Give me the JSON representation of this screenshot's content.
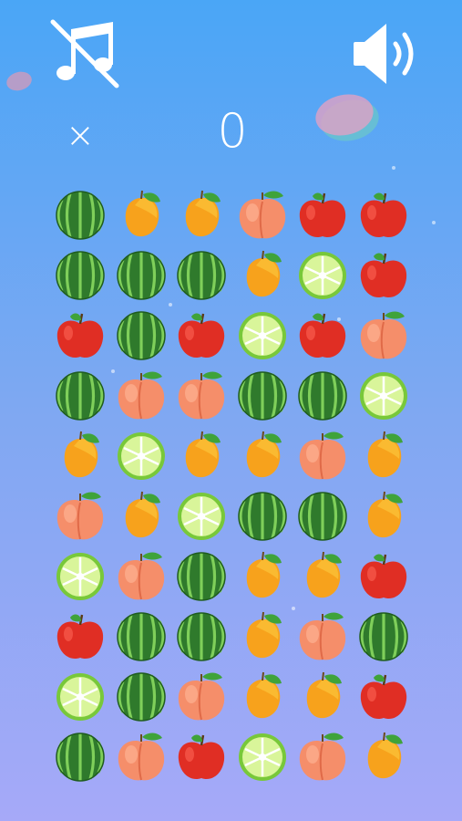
{
  "hud": {
    "multiplier_symbol": "×",
    "score": "0"
  },
  "icons": {
    "music": "music-off-icon",
    "sound": "speaker-on-icon"
  },
  "colors": {
    "bg_top": "#4aa6f6",
    "bg_bottom": "#a6a9f8",
    "hud_text": "#ffffff"
  },
  "board": {
    "rows": 10,
    "cols": 6,
    "grid": [
      [
        "watermelon",
        "mango",
        "mango",
        "peach",
        "apple",
        "apple"
      ],
      [
        "watermelon",
        "watermelon",
        "watermelon",
        "mango",
        "lime",
        "apple"
      ],
      [
        "apple",
        "watermelon",
        "apple",
        "lime",
        "apple",
        "peach"
      ],
      [
        "watermelon",
        "peach",
        "peach",
        "watermelon",
        "watermelon",
        "lime"
      ],
      [
        "mango",
        "lime",
        "mango",
        "mango",
        "peach",
        "mango"
      ],
      [
        "peach",
        "mango",
        "lime",
        "watermelon",
        "watermelon",
        "mango"
      ],
      [
        "lime",
        "peach",
        "watermelon",
        "mango",
        "mango",
        "apple"
      ],
      [
        "apple",
        "watermelon",
        "watermelon",
        "mango",
        "peach",
        "watermelon"
      ],
      [
        "lime",
        "watermelon",
        "peach",
        "mango",
        "mango",
        "apple"
      ],
      [
        "watermelon",
        "peach",
        "apple",
        "lime",
        "peach",
        "mango"
      ]
    ]
  }
}
